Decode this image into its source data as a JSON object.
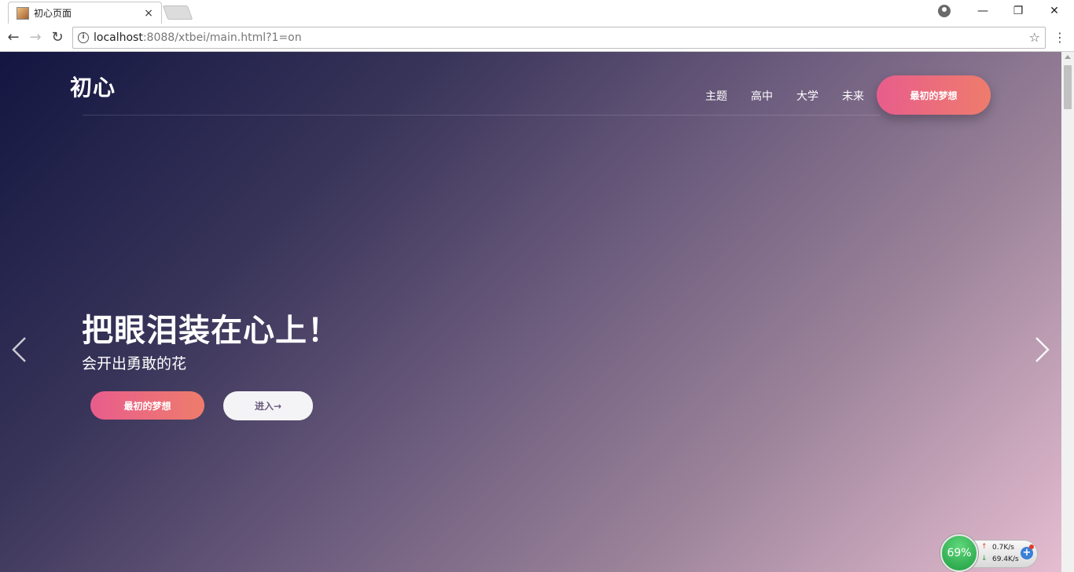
{
  "browser": {
    "tab_title": "初心页面",
    "tab_close": "×",
    "window_minimize": "—",
    "window_maximize": "❐",
    "window_close": "✕",
    "url_host": "localhost",
    "url_rest": ":8088/xtbei/main.html?1=on",
    "info_glyph": "i",
    "star_glyph": "☆",
    "menu_glyph": "⋮",
    "back_glyph": "←",
    "forward_glyph": "→",
    "reload_glyph": "↻"
  },
  "page": {
    "logo": "初心",
    "nav": [
      "主题",
      "高中",
      "大学",
      "未来"
    ],
    "header_cta": "最初的梦想",
    "hero_title": "把眼泪装在心上！",
    "hero_subtitle": "会开出勇敢的花",
    "hero_primary_button": "最初的梦想",
    "hero_secondary_button": "进入→"
  },
  "net_widget": {
    "percent": "69%",
    "upload": "0.7K/s",
    "download": "69.4K/s",
    "up_glyph": "↑",
    "down_glyph": "↓",
    "plus_glyph": "+"
  },
  "colors": {
    "accent_gradient_start": "#e85d8c",
    "accent_gradient_end": "#ee7c6c",
    "bg_dark": "#131641",
    "bg_light": "#e6bdd1"
  },
  "icons": [
    "info-icon",
    "star-icon",
    "menu-icon",
    "back-icon",
    "forward-icon",
    "reload-icon",
    "profile-icon",
    "chevron-left-icon",
    "chevron-right-icon"
  ]
}
